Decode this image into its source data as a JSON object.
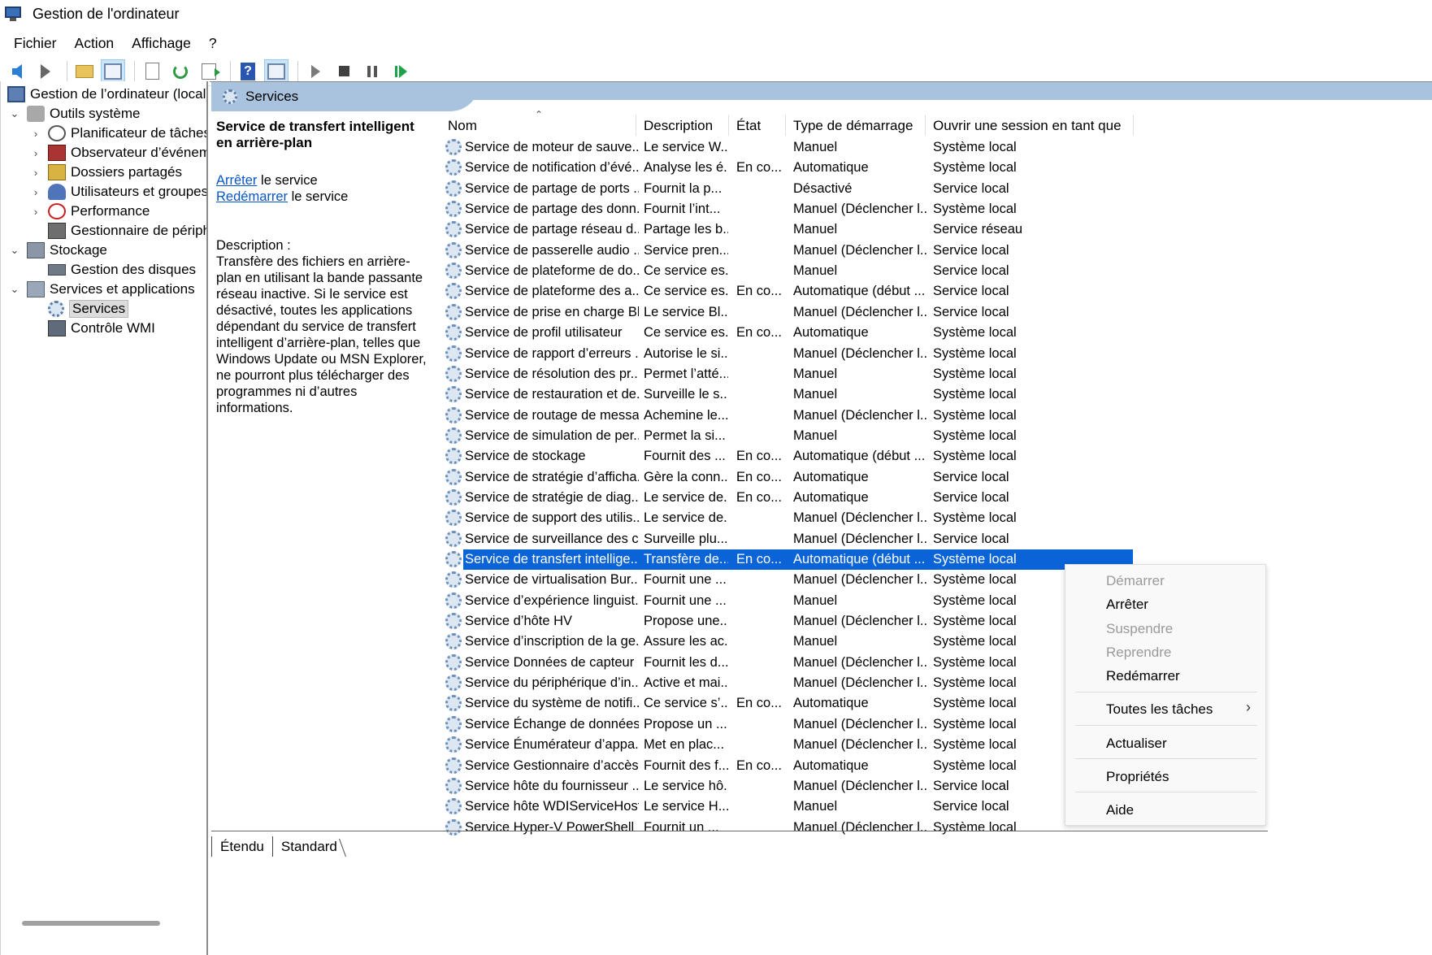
{
  "window": {
    "title": "Gestion de l'ordinateur"
  },
  "menu": [
    "Fichier",
    "Action",
    "Affichage",
    "?"
  ],
  "tree": {
    "root": "Gestion de l’ordinateur (local)",
    "system_tools": "Outils système",
    "task_scheduler": "Planificateur de tâches",
    "event_viewer": "Observateur d’événeme",
    "shared_folders": "Dossiers partagés",
    "local_users": "Utilisateurs et groupes l",
    "performance": "Performance",
    "device_manager": "Gestionnaire de périphé",
    "storage": "Stockage",
    "disk_management": "Gestion des disques",
    "services_apps": "Services et applications",
    "services": "Services",
    "wmi": "Contrôle WMI"
  },
  "panel": {
    "header": "Services",
    "selected_title": "Service de transfert intelligent en arrière-plan",
    "stop_link": "Arrêter",
    "stop_suffix": " le service",
    "restart_link": "Redémarrer",
    "restart_suffix": " le service",
    "description_label": "Description :",
    "description_text": "Transfère des fichiers en arrière-plan en utilisant la bande passante réseau inactive. Si le service est désactivé, toutes les applications dépendant du service de transfert intelligent d’arrière-plan, telles que Windows Update ou MSN Explorer, ne pourront plus télécharger des programmes ni d’autres informations."
  },
  "columns": {
    "name": "Nom",
    "description": "Description",
    "state": "État",
    "startup": "Type de démarrage",
    "logon": "Ouvrir une session en tant que"
  },
  "services": [
    {
      "name": "Service de moteur de sauve...",
      "desc": "Le service W...",
      "state": "",
      "startup": "Manuel",
      "logon": "Système local"
    },
    {
      "name": "Service de notification d’évé...",
      "desc": "Analyse les é...",
      "state": "En co...",
      "startup": "Automatique",
      "logon": "Système local"
    },
    {
      "name": "Service de partage de ports ...",
      "desc": "Fournit la p...",
      "state": "",
      "startup": "Désactivé",
      "logon": "Service local"
    },
    {
      "name": "Service de partage des donn...",
      "desc": "Fournit l’int...",
      "state": "",
      "startup": "Manuel (Déclencher l...",
      "logon": "Système local"
    },
    {
      "name": "Service de partage réseau d...",
      "desc": "Partage les b...",
      "state": "",
      "startup": "Manuel",
      "logon": "Service réseau"
    },
    {
      "name": "Service de passerelle audio ...",
      "desc": "Service pren...",
      "state": "",
      "startup": "Manuel (Déclencher l...",
      "logon": "Service local"
    },
    {
      "name": "Service de plateforme de do...",
      "desc": "Ce service es...",
      "state": "",
      "startup": "Manuel",
      "logon": "Service local"
    },
    {
      "name": "Service de plateforme des a...",
      "desc": "Ce service es...",
      "state": "En co...",
      "startup": "Automatique (début ...",
      "logon": "Service local"
    },
    {
      "name": "Service de prise en charge Bl...",
      "desc": "Le service Bl...",
      "state": "",
      "startup": "Manuel (Déclencher l...",
      "logon": "Service local"
    },
    {
      "name": "Service de profil utilisateur",
      "desc": "Ce service es...",
      "state": "En co...",
      "startup": "Automatique",
      "logon": "Système local"
    },
    {
      "name": "Service de rapport d’erreurs ...",
      "desc": "Autorise le si...",
      "state": "",
      "startup": "Manuel (Déclencher l...",
      "logon": "Système local"
    },
    {
      "name": "Service de résolution des pr...",
      "desc": "Permet l’atté...",
      "state": "",
      "startup": "Manuel",
      "logon": "Système local"
    },
    {
      "name": "Service de restauration et de...",
      "desc": "Surveille le s...",
      "state": "",
      "startup": "Manuel",
      "logon": "Système local"
    },
    {
      "name": "Service de routage de messa...",
      "desc": "Achemine le...",
      "state": "",
      "startup": "Manuel (Déclencher l...",
      "logon": "Système local"
    },
    {
      "name": "Service de simulation de per...",
      "desc": "Permet la si...",
      "state": "",
      "startup": "Manuel",
      "logon": "Système local"
    },
    {
      "name": "Service de stockage",
      "desc": "Fournit des ...",
      "state": "En co...",
      "startup": "Automatique (début ...",
      "logon": "Système local"
    },
    {
      "name": "Service de stratégie d’afficha...",
      "desc": "Gère la conn...",
      "state": "En co...",
      "startup": "Automatique",
      "logon": "Service local"
    },
    {
      "name": "Service de stratégie de diag...",
      "desc": "Le service de...",
      "state": "En co...",
      "startup": "Automatique",
      "logon": "Service local"
    },
    {
      "name": "Service de support des utilis...",
      "desc": "Le service de...",
      "state": "",
      "startup": "Manuel (Déclencher l...",
      "logon": "Système local"
    },
    {
      "name": "Service de surveillance des c...",
      "desc": "Surveille plu...",
      "state": "",
      "startup": "Manuel (Déclencher l...",
      "logon": "Service local"
    },
    {
      "name": "Service de transfert intellige...",
      "desc": "Transfère de...",
      "state": "En co...",
      "startup": "Automatique (début ...",
      "logon": "Système local",
      "selected": true
    },
    {
      "name": "Service de virtualisation Bur...",
      "desc": "Fournit une ...",
      "state": "",
      "startup": "Manuel (Déclencher l...",
      "logon": "Système local"
    },
    {
      "name": "Service d’expérience linguist...",
      "desc": "Fournit une ...",
      "state": "",
      "startup": "Manuel",
      "logon": "Système local"
    },
    {
      "name": "Service d’hôte HV",
      "desc": "Propose une...",
      "state": "",
      "startup": "Manuel (Déclencher l...",
      "logon": "Système local"
    },
    {
      "name": "Service d’inscription de la ge...",
      "desc": "Assure les ac...",
      "state": "",
      "startup": "Manuel",
      "logon": "Système local"
    },
    {
      "name": "Service Données de capteur",
      "desc": "Fournit les d...",
      "state": "",
      "startup": "Manuel (Déclencher l...",
      "logon": "Système local"
    },
    {
      "name": "Service du périphérique d’in...",
      "desc": "Active et mai...",
      "state": "",
      "startup": "Manuel (Déclencher l...",
      "logon": "Système local"
    },
    {
      "name": "Service du système de notifi...",
      "desc": "Ce service s’...",
      "state": "En co...",
      "startup": "Automatique",
      "logon": "Système local"
    },
    {
      "name": "Service Échange de données...",
      "desc": "Propose un ...",
      "state": "",
      "startup": "Manuel (Déclencher l...",
      "logon": "Système local"
    },
    {
      "name": "Service Énumérateur d’appa...",
      "desc": "Met en plac...",
      "state": "",
      "startup": "Manuel (Déclencher l...",
      "logon": "Système local"
    },
    {
      "name": "Service Gestionnaire d’accès ...",
      "desc": "Fournit des f...",
      "state": "En co...",
      "startup": "Automatique",
      "logon": "Système local"
    },
    {
      "name": "Service hôte du fournisseur ...",
      "desc": "Le service hô...",
      "state": "",
      "startup": "Manuel (Déclencher l...",
      "logon": "Service local"
    },
    {
      "name": "Service hôte WDIServiceHost",
      "desc": "Le service H...",
      "state": "",
      "startup": "Manuel",
      "logon": "Service local"
    },
    {
      "name": "Service Hyper-V PowerShell ...",
      "desc": "Fournit un ...",
      "state": "",
      "startup": "Manuel (Déclencher l...",
      "logon": "Système local"
    }
  ],
  "tabs": {
    "extended": "Étendu",
    "standard": "Standard"
  },
  "context_menu": {
    "start": "Démarrer",
    "stop": "Arrêter",
    "pause": "Suspendre",
    "resume": "Reprendre",
    "restart": "Redémarrer",
    "all_tasks": "Toutes les tâches",
    "refresh": "Actualiser",
    "properties": "Propriétés",
    "help": "Aide"
  }
}
